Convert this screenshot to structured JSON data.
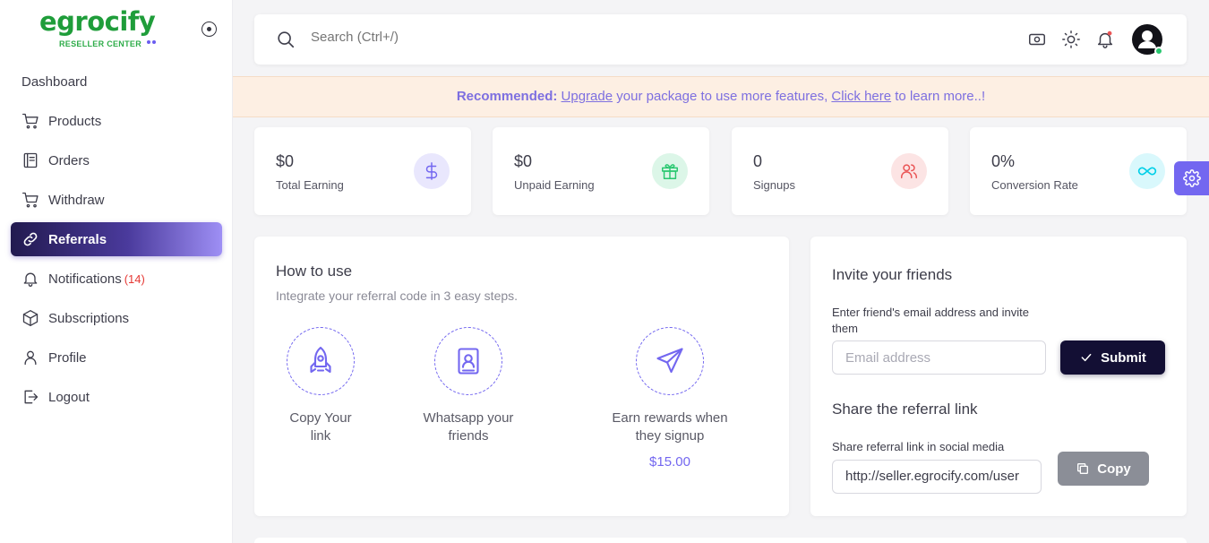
{
  "brand": {
    "name": "egrocify",
    "sub": "RESELLER CENTER"
  },
  "sidebar": {
    "items": [
      {
        "label": "Dashboard"
      },
      {
        "label": "Products"
      },
      {
        "label": "Orders"
      },
      {
        "label": "Withdraw"
      },
      {
        "label": "Referrals"
      },
      {
        "label": "Notifications",
        "badge": "(14)"
      },
      {
        "label": "Subscriptions"
      },
      {
        "label": "Profile"
      },
      {
        "label": "Logout"
      }
    ]
  },
  "topbar": {
    "search_placeholder": "Search (Ctrl+/)"
  },
  "banner": {
    "prefix": "Recommended:",
    "link1": "Upgrade",
    "mid": "your package to use more features,",
    "link2": "Click here",
    "suffix": "to learn more..!"
  },
  "stats": [
    {
      "value": "$0",
      "label": "Total Earning",
      "color": "#7367f0"
    },
    {
      "value": "$0",
      "label": "Unpaid Earning",
      "color": "#28c76f"
    },
    {
      "value": "0",
      "label": "Signups",
      "color": "#ea5455"
    },
    {
      "value": "0%",
      "label": "Conversion Rate",
      "color": "#00cfe8"
    }
  ],
  "howto": {
    "title": "How to use",
    "subtitle": "Integrate your referral code in 3 easy steps.",
    "steps": [
      {
        "line1": "Copy Your",
        "line2": "link"
      },
      {
        "line1": "Whatsapp your",
        "line2": "friends"
      },
      {
        "line1": "Earn rewards when",
        "line2": "they signup",
        "amount": "$15.00"
      }
    ]
  },
  "invite": {
    "title": "Invite your friends",
    "email_help": "Enter friend's email address and invite them",
    "email_placeholder": "Email address",
    "submit_label": "Submit",
    "share_title": "Share the referral link",
    "share_help": "Share referral link in social media",
    "link_value": "http://seller.egrocify.com/user",
    "copy_label": "Copy"
  },
  "colors": {
    "accent": "#7367f0",
    "dark_button": "#130f34",
    "banner_bg": "#fdefe3"
  }
}
